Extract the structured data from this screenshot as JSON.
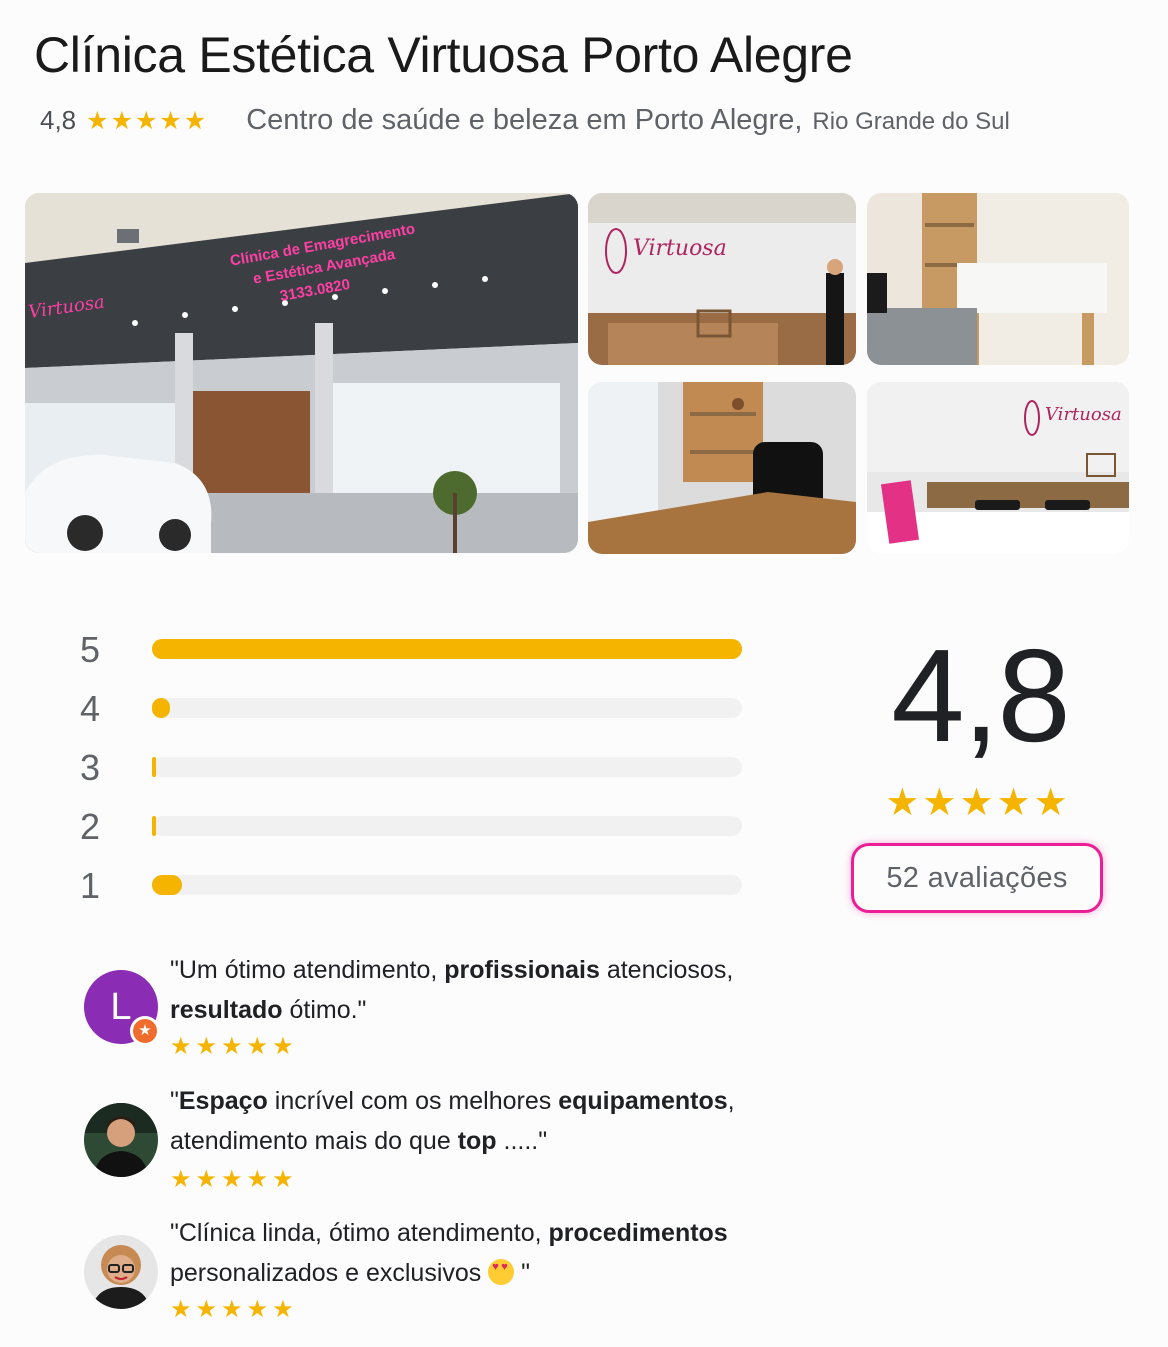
{
  "header": {
    "title": "Clínica Estética Virtuosa Porto Alegre",
    "rating": "4,8",
    "stars": "★★★★★",
    "category": "Centro de saúde e beleza em Porto Alegre,",
    "region": "Rio Grande do Sul"
  },
  "photos": {
    "storefront_sign_line1": "Clínica de Emagrecimento",
    "storefront_sign_line2": "e Estética Avançada",
    "storefront_phone": "3133.0820",
    "logo_text": "Virtuosa"
  },
  "histogram": {
    "rows": [
      {
        "label": "5",
        "fraction": 1.0
      },
      {
        "label": "4",
        "fraction": 0.03
      },
      {
        "label": "3",
        "fraction": 0.0
      },
      {
        "label": "2",
        "fraction": 0.0
      },
      {
        "label": "1",
        "fraction": 0.05
      }
    ],
    "bar_color": "#f5b400"
  },
  "summary": {
    "score": "4,8",
    "stars": "★★★★★",
    "review_count": "52 avaliações",
    "highlight_color": "#ec1e95"
  },
  "reviews": [
    {
      "avatar_letter": "L",
      "badge_icon": "★",
      "stars": "★★★★★",
      "parts": [
        {
          "t": "\"Um ótimo atendimento, ",
          "b": false
        },
        {
          "t": "profissionais",
          "b": true
        },
        {
          "t": " atenciosos, ",
          "b": false
        },
        {
          "t": "resultado",
          "b": true
        },
        {
          "t": " ótimo.\"",
          "b": false
        }
      ]
    },
    {
      "stars": "★★★★★",
      "parts": [
        {
          "t": "\"",
          "b": false
        },
        {
          "t": "Espaço",
          "b": true
        },
        {
          "t": " incrível com os melhores ",
          "b": false
        },
        {
          "t": "equipamentos",
          "b": true
        },
        {
          "t": ", atendimento mais do que ",
          "b": false
        },
        {
          "t": "top",
          "b": true
        },
        {
          "t": " .....\"",
          "b": false
        }
      ]
    },
    {
      "stars": "★★★★★",
      "parts": [
        {
          "t": "\"Clínica linda, ótimo atendimento, ",
          "b": false
        },
        {
          "t": "procedimentos",
          "b": true
        },
        {
          "t": " personalizados e exclusivos ",
          "b": false
        }
      ],
      "emoji": "heart-eyes-emoji",
      "closing": " \""
    }
  ]
}
